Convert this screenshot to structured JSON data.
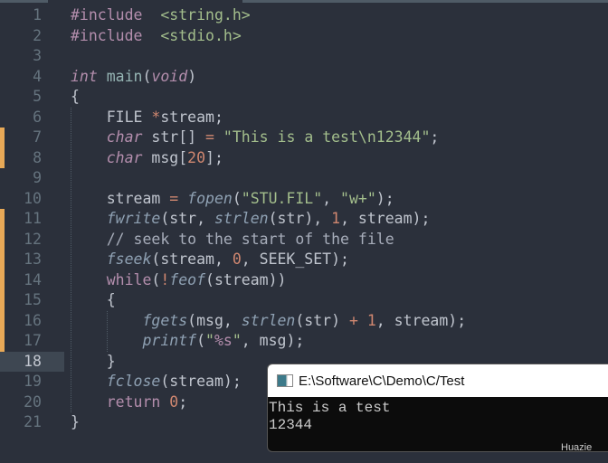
{
  "editor": {
    "current_line": 18,
    "modified_lines": [
      7,
      8,
      11,
      12,
      13,
      14,
      15,
      16,
      17
    ],
    "lines": [
      {
        "n": "1",
        "tokens": [
          [
            "kw",
            "#include"
          ],
          [
            "",
            "  "
          ],
          [
            "str",
            "<string.h>"
          ]
        ]
      },
      {
        "n": "2",
        "tokens": [
          [
            "kw",
            "#include"
          ],
          [
            "",
            "  "
          ],
          [
            "str",
            "<stdio.h>"
          ]
        ]
      },
      {
        "n": "3",
        "tokens": []
      },
      {
        "n": "4",
        "tokens": [
          [
            "kwi",
            "int"
          ],
          [
            "",
            " "
          ],
          [
            "fnm",
            "main"
          ],
          [
            "",
            "("
          ],
          [
            "kwi",
            "void"
          ],
          [
            "",
            ")"
          ]
        ]
      },
      {
        "n": "5",
        "tokens": [
          [
            "",
            "{"
          ]
        ]
      },
      {
        "n": "6",
        "tokens": [
          [
            "",
            "    FILE "
          ],
          [
            "op",
            "*"
          ],
          [
            "",
            "stream;"
          ]
        ]
      },
      {
        "n": "7",
        "tokens": [
          [
            "",
            "    "
          ],
          [
            "kwi",
            "char"
          ],
          [
            "",
            " str[] "
          ],
          [
            "op",
            "="
          ],
          [
            "",
            " "
          ],
          [
            "str",
            "\"This is a test\\n12344\""
          ],
          [
            "",
            ";"
          ]
        ]
      },
      {
        "n": "8",
        "tokens": [
          [
            "",
            "    "
          ],
          [
            "kwi",
            "char"
          ],
          [
            "",
            " msg["
          ],
          [
            "num",
            "20"
          ],
          [
            "",
            "];"
          ]
        ]
      },
      {
        "n": "9",
        "tokens": []
      },
      {
        "n": "10",
        "tokens": [
          [
            "",
            "    stream "
          ],
          [
            "op",
            "="
          ],
          [
            "",
            " "
          ],
          [
            "fn",
            "fopen"
          ],
          [
            "",
            "("
          ],
          [
            "str",
            "\"STU.FIL\""
          ],
          [
            "",
            ", "
          ],
          [
            "str",
            "\"w+\""
          ],
          [
            "",
            ");"
          ]
        ]
      },
      {
        "n": "11",
        "tokens": [
          [
            "",
            "    "
          ],
          [
            "fn",
            "fwrite"
          ],
          [
            "",
            "(str, "
          ],
          [
            "fn",
            "strlen"
          ],
          [
            "",
            "(str), "
          ],
          [
            "num",
            "1"
          ],
          [
            "",
            ", stream);"
          ]
        ]
      },
      {
        "n": "12",
        "tokens": [
          [
            "",
            "    "
          ],
          [
            "cm",
            "// seek to the start of the file"
          ]
        ]
      },
      {
        "n": "13",
        "tokens": [
          [
            "",
            "    "
          ],
          [
            "fn",
            "fseek"
          ],
          [
            "",
            "(stream, "
          ],
          [
            "num",
            "0"
          ],
          [
            "",
            ", SEEK_SET);"
          ]
        ]
      },
      {
        "n": "14",
        "tokens": [
          [
            "",
            "    "
          ],
          [
            "kw",
            "while"
          ],
          [
            "",
            "("
          ],
          [
            "op",
            "!"
          ],
          [
            "fn",
            "feof"
          ],
          [
            "",
            "(stream))"
          ]
        ]
      },
      {
        "n": "15",
        "tokens": [
          [
            "",
            "    {"
          ]
        ]
      },
      {
        "n": "16",
        "tokens": [
          [
            "",
            "        "
          ],
          [
            "fn",
            "fgets"
          ],
          [
            "",
            "(msg, "
          ],
          [
            "fn",
            "strlen"
          ],
          [
            "",
            "(str) "
          ],
          [
            "op",
            "+"
          ],
          [
            "",
            " "
          ],
          [
            "num",
            "1"
          ],
          [
            "",
            ", stream);"
          ]
        ]
      },
      {
        "n": "17",
        "tokens": [
          [
            "",
            "        "
          ],
          [
            "fn",
            "printf"
          ],
          [
            "",
            "("
          ],
          [
            "str",
            "\""
          ],
          [
            "fmt",
            "%s"
          ],
          [
            "str",
            "\""
          ],
          [
            "",
            ", msg);"
          ]
        ]
      },
      {
        "n": "18",
        "tokens": [
          [
            "",
            "    }"
          ]
        ]
      },
      {
        "n": "19",
        "tokens": [
          [
            "",
            "    "
          ],
          [
            "fn",
            "fclose"
          ],
          [
            "",
            "(stream);"
          ]
        ]
      },
      {
        "n": "20",
        "tokens": [
          [
            "",
            "    "
          ],
          [
            "kw",
            "return"
          ],
          [
            "",
            " "
          ],
          [
            "num",
            "0"
          ],
          [
            "",
            ";"
          ]
        ]
      },
      {
        "n": "21",
        "tokens": [
          [
            "",
            "}"
          ]
        ]
      }
    ]
  },
  "console": {
    "title": "E:\\Software\\C\\Demo\\C/Test",
    "output_line1": "This is a test",
    "output_line2": "12344"
  },
  "watermark": "Huazie"
}
